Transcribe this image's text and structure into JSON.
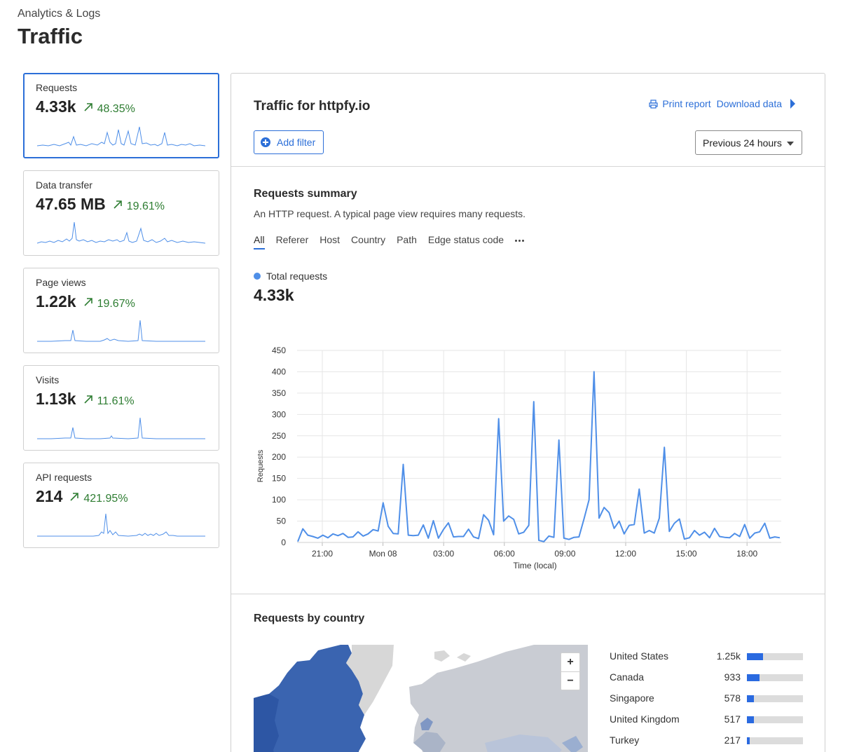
{
  "header": {
    "breadcrumb": "Analytics & Logs",
    "title": "Traffic"
  },
  "metrics": [
    {
      "label": "Requests",
      "value": "4.33k",
      "change": "48.35%"
    },
    {
      "label": "Data transfer",
      "value": "47.65 MB",
      "change": "19.61%"
    },
    {
      "label": "Page views",
      "value": "1.22k",
      "change": "19.67%"
    },
    {
      "label": "Visits",
      "value": "1.13k",
      "change": "11.61%"
    },
    {
      "label": "API requests",
      "value": "214",
      "change": "421.95%"
    }
  ],
  "panel": {
    "title": "Traffic for httpfy.io",
    "print_label": "Print report",
    "download_label": "Download data",
    "add_filter_label": "Add filter",
    "range_label": "Previous 24 hours"
  },
  "summary": {
    "title": "Requests summary",
    "description": "An HTTP request. A typical page view requires many requests.",
    "tabs": [
      "All",
      "Referer",
      "Host",
      "Country",
      "Path",
      "Edge status code"
    ],
    "legend_label": "Total requests",
    "total": "4.33k"
  },
  "colors": {
    "accent": "#2c6fd8",
    "line": "#4f8fe8",
    "positive": "#2e7d32",
    "map_highlight": "#3a64b0"
  },
  "chart_data": {
    "type": "line",
    "xlabel": "Time (local)",
    "ylabel": "Requests",
    "ylim": [
      0,
      450
    ],
    "yticks": [
      0,
      50,
      100,
      150,
      200,
      250,
      300,
      350,
      400,
      450
    ],
    "xtick_labels": [
      "21:00",
      "Mon 08",
      "03:00",
      "06:00",
      "09:00",
      "12:00",
      "15:00",
      "18:00"
    ],
    "grid": true,
    "series": [
      {
        "values": [
          2,
          32,
          17,
          14,
          10,
          17,
          11,
          20,
          16,
          21,
          12,
          13,
          25,
          15,
          20,
          30,
          27,
          93,
          38,
          21,
          20,
          183,
          17,
          16,
          17,
          41,
          10,
          51,
          10,
          30,
          46,
          13,
          14,
          14,
          31,
          13,
          9,
          65,
          52,
          18,
          290,
          50,
          62,
          54,
          20,
          24,
          40,
          330,
          5,
          2,
          15,
          12,
          240,
          10,
          7,
          12,
          13,
          55,
          100,
          400,
          57,
          82,
          70,
          33,
          50,
          20,
          40,
          42,
          125,
          22,
          28,
          22,
          57,
          223,
          26,
          45,
          55,
          8,
          11,
          28,
          17,
          24,
          11,
          33,
          14,
          12,
          11,
          21,
          14,
          42,
          10,
          22,
          25,
          45,
          10,
          13,
          11
        ]
      }
    ]
  },
  "countries": {
    "title": "Requests by country",
    "items": [
      {
        "name": "United States",
        "value": "1.25k",
        "fraction": 0.29
      },
      {
        "name": "Canada",
        "value": "933",
        "fraction": 0.22
      },
      {
        "name": "Singapore",
        "value": "578",
        "fraction": 0.13
      },
      {
        "name": "United Kingdom",
        "value": "517",
        "fraction": 0.12
      },
      {
        "name": "Turkey",
        "value": "217",
        "fraction": 0.05
      }
    ]
  }
}
